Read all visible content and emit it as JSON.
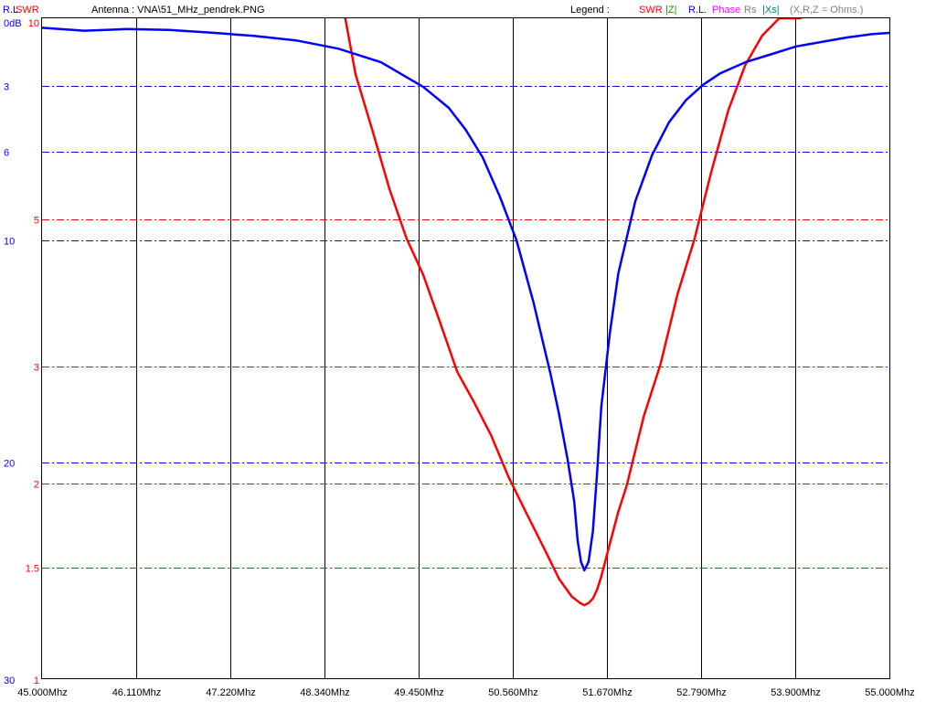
{
  "header": {
    "rl_label": "R.L",
    "swr_label": "SWR",
    "file_title": "Antenna : VNA\\51_MHz_pendrek.PNG",
    "legend_label": "Legend :",
    "legend_items": [
      {
        "label": "SWR",
        "color": "#ff0000"
      },
      {
        "label": "|Z|",
        "color": "#00a000"
      },
      {
        "label": "R.L.",
        "color": "#0000ff"
      },
      {
        "label": "Phase",
        "color": "#ff00ff"
      },
      {
        "label": "Rs",
        "color": "#808080"
      },
      {
        "label": "|Xs|",
        "color": "#008080"
      },
      {
        "label": "(X,R,Z = Ohms.)",
        "color": "#808080"
      }
    ]
  },
  "colors": {
    "swr": "#ff0000",
    "rl": "#0000ff",
    "grid_vertical": "#000000",
    "frame": "#000000"
  },
  "chart_data": {
    "type": "line",
    "title": "Antenna : VNA\\51_MHz_pendrek.PNG",
    "xlabel": "",
    "x_unit": "Mhz",
    "xlim": [
      45.0,
      55.0
    ],
    "x_ticks": [
      "45.000Mhz",
      "46.110Mhz",
      "47.220Mhz",
      "48.340Mhz",
      "49.450Mhz",
      "50.560Mhz",
      "51.670Mhz",
      "52.790Mhz",
      "53.900Mhz",
      "55.000Mhz"
    ],
    "rl_axis": {
      "unit_label": "dB",
      "ticks": [
        {
          "label": "0dB",
          "value": 0
        },
        {
          "label": "3",
          "value": 3
        },
        {
          "label": "6",
          "value": 6
        },
        {
          "label": "10",
          "value": 10
        },
        {
          "label": "20",
          "value": 20
        },
        {
          "label": "30",
          "value": 30
        }
      ],
      "range": [
        0,
        30
      ]
    },
    "swr_axis": {
      "scale": "log",
      "ticks": [
        {
          "label": "10",
          "value": 10
        },
        {
          "label": "5",
          "value": 5
        },
        {
          "label": "3",
          "value": 3
        },
        {
          "label": "2",
          "value": 2
        },
        {
          "label": "1.5",
          "value": 1.5
        },
        {
          "label": "1",
          "value": 1
        }
      ],
      "range": [
        1,
        10
      ]
    },
    "grid": true,
    "series": [
      {
        "name": "SWR",
        "color": "#ff0000",
        "axis": "swr",
        "x": [
          48.52,
          48.7,
          48.9,
          49.1,
          49.3,
          49.5,
          49.7,
          49.9,
          50.1,
          50.3,
          50.5,
          50.7,
          50.9,
          51.1,
          51.25,
          51.35,
          51.4,
          51.45,
          51.5,
          51.55,
          51.6,
          51.7,
          51.8,
          51.9,
          52.1,
          52.3,
          52.5,
          52.7,
          52.9,
          53.1,
          53.3,
          53.5,
          53.7,
          53.85,
          53.95
        ],
        "values": [
          10.0,
          7.8,
          6.4,
          5.4,
          4.6,
          3.97,
          3.39,
          2.93,
          2.58,
          2.3,
          2.04,
          1.79,
          1.6,
          1.45,
          1.37,
          1.34,
          1.33,
          1.34,
          1.36,
          1.4,
          1.46,
          1.6,
          1.78,
          1.98,
          2.45,
          3.02,
          3.72,
          4.58,
          5.67,
          6.85,
          8.1,
          9.2,
          10.0,
          10.0,
          10.0
        ]
      },
      {
        "name": "R.L.",
        "color": "#0000ff",
        "axis": "rl",
        "x": [
          45.0,
          45.5,
          46.0,
          46.5,
          47.0,
          47.5,
          48.0,
          48.5,
          49.0,
          49.5,
          49.8,
          50.0,
          50.2,
          50.4,
          50.6,
          50.8,
          51.0,
          51.1,
          51.2,
          51.28,
          51.32,
          51.36,
          51.4,
          51.45,
          51.5,
          51.55,
          51.6,
          51.7,
          51.8,
          52.0,
          52.2,
          52.4,
          52.6,
          52.8,
          53.0,
          53.3,
          53.6,
          53.9,
          54.2,
          54.5,
          54.8,
          55.0
        ],
        "values": [
          0.42,
          0.55,
          0.48,
          0.52,
          0.64,
          0.78,
          0.98,
          1.35,
          1.95,
          3.05,
          4.0,
          5.0,
          6.25,
          8.0,
          10.0,
          12.8,
          16.0,
          17.8,
          19.8,
          21.8,
          23.6,
          24.6,
          25.0,
          24.6,
          23.2,
          20.5,
          17.5,
          14.2,
          11.5,
          8.25,
          6.15,
          4.65,
          3.65,
          2.95,
          2.45,
          1.95,
          1.6,
          1.25,
          1.05,
          0.85,
          0.7,
          0.65
        ]
      }
    ]
  }
}
